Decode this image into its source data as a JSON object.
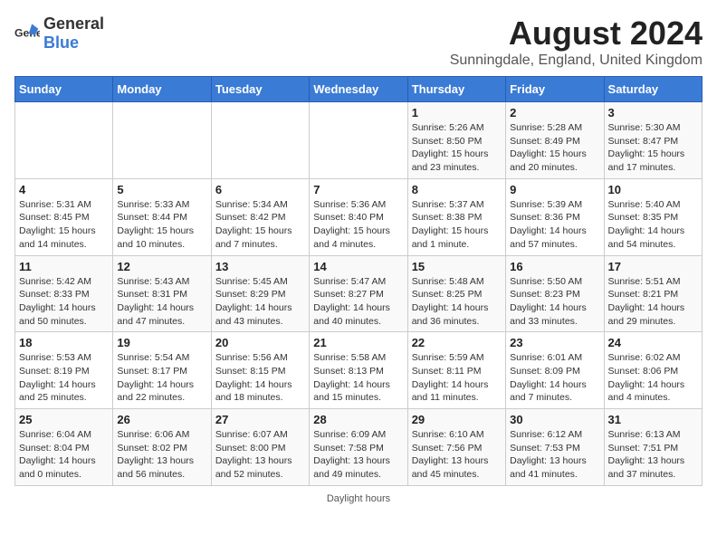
{
  "header": {
    "logo_general": "General",
    "logo_blue": "Blue",
    "title": "August 2024",
    "subtitle": "Sunningdale, England, United Kingdom"
  },
  "calendar": {
    "days_of_week": [
      "Sunday",
      "Monday",
      "Tuesday",
      "Wednesday",
      "Thursday",
      "Friday",
      "Saturday"
    ],
    "weeks": [
      [
        {
          "day": "",
          "info": ""
        },
        {
          "day": "",
          "info": ""
        },
        {
          "day": "",
          "info": ""
        },
        {
          "day": "",
          "info": ""
        },
        {
          "day": "1",
          "info": "Sunrise: 5:26 AM\nSunset: 8:50 PM\nDaylight: 15 hours and 23 minutes."
        },
        {
          "day": "2",
          "info": "Sunrise: 5:28 AM\nSunset: 8:49 PM\nDaylight: 15 hours and 20 minutes."
        },
        {
          "day": "3",
          "info": "Sunrise: 5:30 AM\nSunset: 8:47 PM\nDaylight: 15 hours and 17 minutes."
        }
      ],
      [
        {
          "day": "4",
          "info": "Sunrise: 5:31 AM\nSunset: 8:45 PM\nDaylight: 15 hours and 14 minutes."
        },
        {
          "day": "5",
          "info": "Sunrise: 5:33 AM\nSunset: 8:44 PM\nDaylight: 15 hours and 10 minutes."
        },
        {
          "day": "6",
          "info": "Sunrise: 5:34 AM\nSunset: 8:42 PM\nDaylight: 15 hours and 7 minutes."
        },
        {
          "day": "7",
          "info": "Sunrise: 5:36 AM\nSunset: 8:40 PM\nDaylight: 15 hours and 4 minutes."
        },
        {
          "day": "8",
          "info": "Sunrise: 5:37 AM\nSunset: 8:38 PM\nDaylight: 15 hours and 1 minute."
        },
        {
          "day": "9",
          "info": "Sunrise: 5:39 AM\nSunset: 8:36 PM\nDaylight: 14 hours and 57 minutes."
        },
        {
          "day": "10",
          "info": "Sunrise: 5:40 AM\nSunset: 8:35 PM\nDaylight: 14 hours and 54 minutes."
        }
      ],
      [
        {
          "day": "11",
          "info": "Sunrise: 5:42 AM\nSunset: 8:33 PM\nDaylight: 14 hours and 50 minutes."
        },
        {
          "day": "12",
          "info": "Sunrise: 5:43 AM\nSunset: 8:31 PM\nDaylight: 14 hours and 47 minutes."
        },
        {
          "day": "13",
          "info": "Sunrise: 5:45 AM\nSunset: 8:29 PM\nDaylight: 14 hours and 43 minutes."
        },
        {
          "day": "14",
          "info": "Sunrise: 5:47 AM\nSunset: 8:27 PM\nDaylight: 14 hours and 40 minutes."
        },
        {
          "day": "15",
          "info": "Sunrise: 5:48 AM\nSunset: 8:25 PM\nDaylight: 14 hours and 36 minutes."
        },
        {
          "day": "16",
          "info": "Sunrise: 5:50 AM\nSunset: 8:23 PM\nDaylight: 14 hours and 33 minutes."
        },
        {
          "day": "17",
          "info": "Sunrise: 5:51 AM\nSunset: 8:21 PM\nDaylight: 14 hours and 29 minutes."
        }
      ],
      [
        {
          "day": "18",
          "info": "Sunrise: 5:53 AM\nSunset: 8:19 PM\nDaylight: 14 hours and 25 minutes."
        },
        {
          "day": "19",
          "info": "Sunrise: 5:54 AM\nSunset: 8:17 PM\nDaylight: 14 hours and 22 minutes."
        },
        {
          "day": "20",
          "info": "Sunrise: 5:56 AM\nSunset: 8:15 PM\nDaylight: 14 hours and 18 minutes."
        },
        {
          "day": "21",
          "info": "Sunrise: 5:58 AM\nSunset: 8:13 PM\nDaylight: 14 hours and 15 minutes."
        },
        {
          "day": "22",
          "info": "Sunrise: 5:59 AM\nSunset: 8:11 PM\nDaylight: 14 hours and 11 minutes."
        },
        {
          "day": "23",
          "info": "Sunrise: 6:01 AM\nSunset: 8:09 PM\nDaylight: 14 hours and 7 minutes."
        },
        {
          "day": "24",
          "info": "Sunrise: 6:02 AM\nSunset: 8:06 PM\nDaylight: 14 hours and 4 minutes."
        }
      ],
      [
        {
          "day": "25",
          "info": "Sunrise: 6:04 AM\nSunset: 8:04 PM\nDaylight: 14 hours and 0 minutes."
        },
        {
          "day": "26",
          "info": "Sunrise: 6:06 AM\nSunset: 8:02 PM\nDaylight: 13 hours and 56 minutes."
        },
        {
          "day": "27",
          "info": "Sunrise: 6:07 AM\nSunset: 8:00 PM\nDaylight: 13 hours and 52 minutes."
        },
        {
          "day": "28",
          "info": "Sunrise: 6:09 AM\nSunset: 7:58 PM\nDaylight: 13 hours and 49 minutes."
        },
        {
          "day": "29",
          "info": "Sunrise: 6:10 AM\nSunset: 7:56 PM\nDaylight: 13 hours and 45 minutes."
        },
        {
          "day": "30",
          "info": "Sunrise: 6:12 AM\nSunset: 7:53 PM\nDaylight: 13 hours and 41 minutes."
        },
        {
          "day": "31",
          "info": "Sunrise: 6:13 AM\nSunset: 7:51 PM\nDaylight: 13 hours and 37 minutes."
        }
      ]
    ]
  },
  "footer": {
    "note": "Daylight hours"
  }
}
